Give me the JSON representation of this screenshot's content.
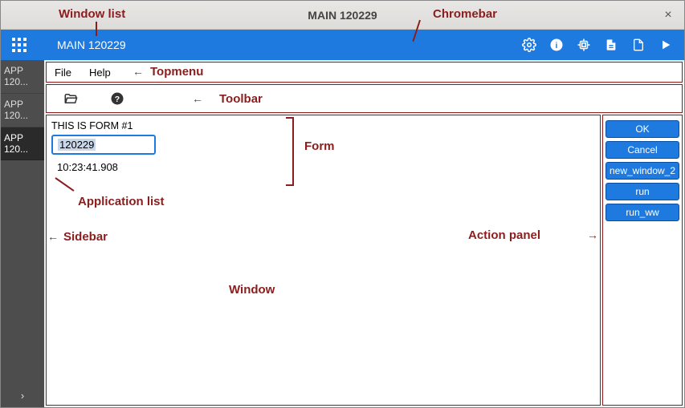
{
  "titlebar": {
    "title": "MAIN 120229",
    "close": "×"
  },
  "chromebar": {
    "app_title": "MAIN 120229",
    "icons": {
      "grid": "grid-apps-icon",
      "gear": "gear-icon",
      "info": "info-icon",
      "chip": "chip-icon",
      "doc": "document-icon",
      "page": "page-icon",
      "play": "play-icon"
    }
  },
  "sidebar": {
    "items": [
      {
        "label": "APP 120..."
      },
      {
        "label": "APP 120..."
      },
      {
        "label": "APP 120...",
        "active": true
      }
    ],
    "chevron": "›"
  },
  "topmenu": {
    "items": [
      "File",
      "Help"
    ]
  },
  "toolbar": {
    "icons": {
      "open": "folder-open-icon",
      "help": "help-circle-icon"
    }
  },
  "form": {
    "title": "THIS IS FORM #1",
    "field1_value": "120229",
    "field2_value": "10:23:41.908"
  },
  "action_panel": {
    "buttons": [
      "OK",
      "Cancel",
      "new_window_2",
      "run",
      "run_ww"
    ]
  },
  "annotations": {
    "window_list": "Window list",
    "chromebar": "Chromebar",
    "topmenu": "Topmenu",
    "toolbar": "Toolbar",
    "form": "Form",
    "application_list": "Application list",
    "sidebar": "Sidebar",
    "window": "Window",
    "action_panel": "Action panel"
  }
}
